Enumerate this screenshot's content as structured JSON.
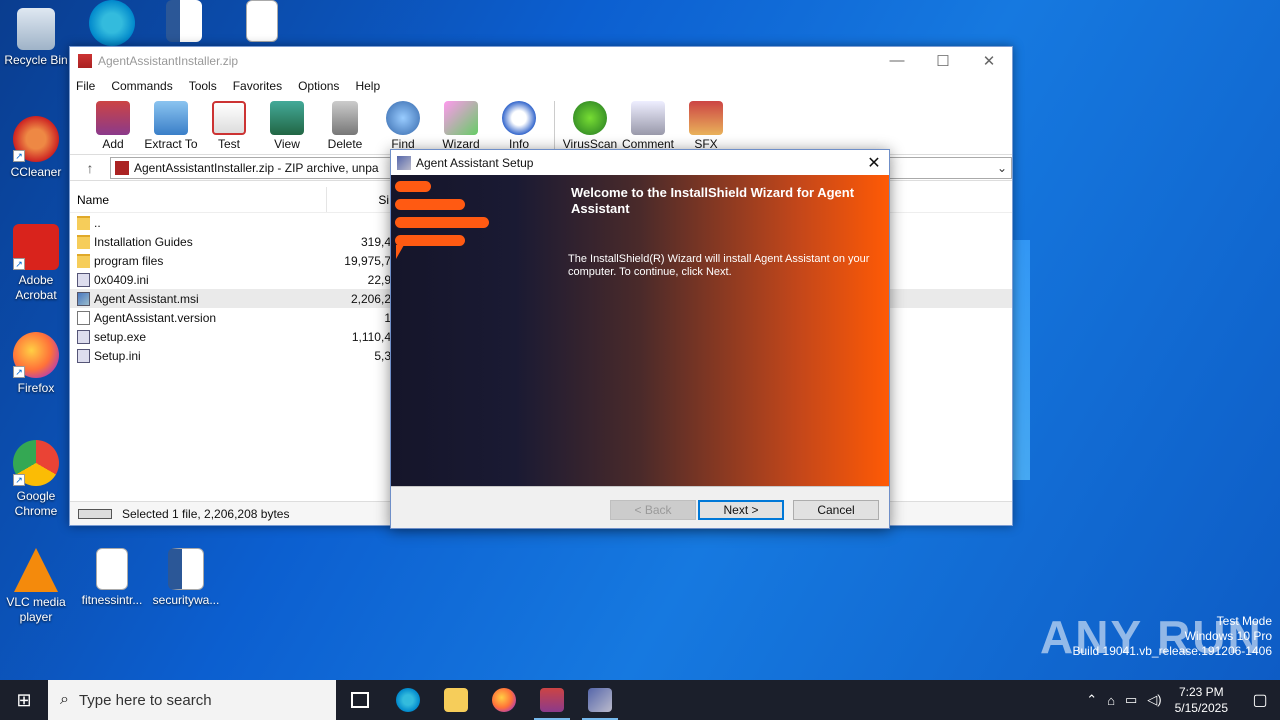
{
  "desktop": {
    "icons": [
      {
        "label": "Recycle Bin"
      },
      {
        "label": "CCleaner"
      },
      {
        "label": "Adobe Acrobat"
      },
      {
        "label": "Firefox"
      },
      {
        "label": "Google Chrome"
      },
      {
        "label": "VLC media player"
      },
      {
        "label": "fitnessintr..."
      },
      {
        "label": "securitywa..."
      }
    ]
  },
  "winrar": {
    "title": "AgentAssistantInstaller.zip",
    "menu": [
      "File",
      "Commands",
      "Tools",
      "Favorites",
      "Options",
      "Help"
    ],
    "toolbar": [
      "Add",
      "Extract To",
      "Test",
      "View",
      "Delete",
      "Find",
      "Wizard",
      "Info",
      "VirusScan",
      "Comment",
      "SFX"
    ],
    "address": "AgentAssistantInstaller.zip - ZIP archive, unpa",
    "columns": {
      "name": "Name",
      "size": "Si"
    },
    "files": [
      {
        "name": "..",
        "size": ""
      },
      {
        "name": "Installation Guides",
        "size": "319,4"
      },
      {
        "name": "program files",
        "size": "19,975,7"
      },
      {
        "name": "0x0409.ini",
        "size": "22,9"
      },
      {
        "name": "Agent Assistant.msi",
        "size": "2,206,2"
      },
      {
        "name": "AgentAssistant.version",
        "size": "1"
      },
      {
        "name": "setup.exe",
        "size": "1,110,4"
      },
      {
        "name": "Setup.ini",
        "size": "5,3"
      }
    ],
    "status": "Selected 1 file, 2,206,208 bytes"
  },
  "setup": {
    "title": "Agent Assistant Setup",
    "heading": "Welcome to the InstallShield Wizard for Agent Assistant",
    "text": "The InstallShield(R) Wizard will install Agent Assistant on your computer. To continue, click Next.",
    "back": "< Back",
    "next": "Next >",
    "cancel": "Cancel"
  },
  "watermark": {
    "logo": "ANY RUN",
    "line1": "Test Mode",
    "line2": "Windows 10 Pro",
    "line3": "Build 19041.vb_release.191206-1406"
  },
  "taskbar": {
    "search_placeholder": "Type here to search",
    "time": "7:23 PM",
    "date": "5/15/2025"
  },
  "colors": {
    "accent": "#0078d7",
    "installer_orange": "#ff5a05"
  }
}
